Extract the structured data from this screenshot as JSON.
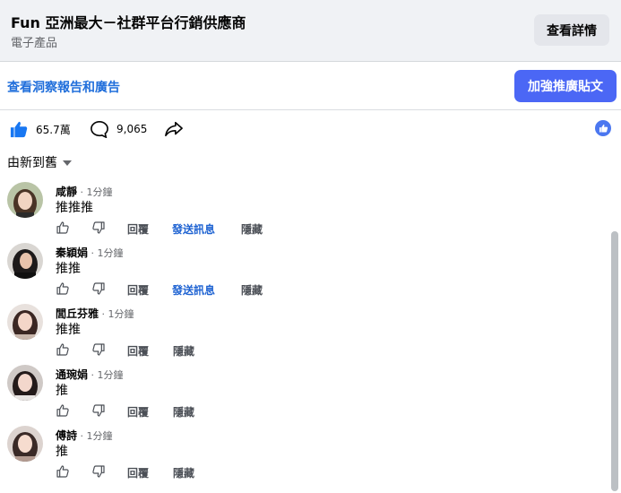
{
  "header": {
    "title": "Fun 亞洲最大－社群平台行銷供應商",
    "subtitle": "電子產品",
    "details_label": "查看詳情"
  },
  "promo": {
    "insights_label": "查看洞察報告和廣告",
    "boost_label": "加強推廣貼文"
  },
  "stats": {
    "likes": "65.7萬",
    "comments": "9,065"
  },
  "sort": {
    "label": "由新到舊"
  },
  "comments": [
    {
      "name": "咸靜",
      "time": "1分鐘",
      "text": "推推推",
      "actions": [
        "回覆",
        "發送訊息",
        "隱藏"
      ]
    },
    {
      "name": "秦穎娟",
      "time": "1分鐘",
      "text": "推推",
      "actions": [
        "回覆",
        "發送訊息",
        "隱藏"
      ]
    },
    {
      "name": "閭丘芬雅",
      "time": "1分鐘",
      "text": "推推",
      "actions": [
        "回覆",
        "隱藏"
      ]
    },
    {
      "name": "通琬娟",
      "time": "1分鐘",
      "text": "推",
      "actions": [
        "回覆",
        "隱藏"
      ]
    },
    {
      "name": "傅詩",
      "time": "1分鐘",
      "text": "推",
      "actions": [
        "回覆",
        "隱藏"
      ]
    }
  ],
  "colors": {
    "accent": "#4b67f5",
    "link": "#216fdb"
  }
}
